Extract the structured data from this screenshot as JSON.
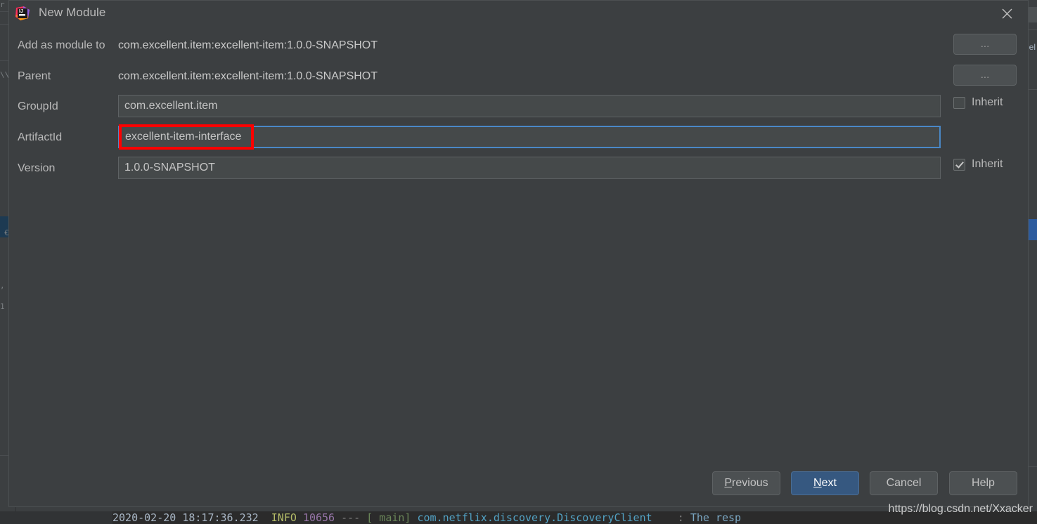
{
  "window": {
    "title": "New Module",
    "app_icon": "intellij-idea-icon",
    "close_icon": "close-icon"
  },
  "form": {
    "rows": [
      {
        "label": "Add as module to",
        "value": "com.excellent.item:excellent-item:1.0.0-SNAPSHOT",
        "type": "static",
        "browse_label": "..."
      },
      {
        "label": "Parent",
        "value": "com.excellent.item:excellent-item:1.0.0-SNAPSHOT",
        "type": "static",
        "browse_label": "..."
      },
      {
        "label": "GroupId",
        "value": "com.excellent.item",
        "type": "input",
        "inherit_label": "Inherit",
        "inherit_checked": false
      },
      {
        "label": "ArtifactId",
        "value": "excellent-item-interface",
        "type": "input",
        "focused": true
      },
      {
        "label": "Version",
        "value": "1.0.0-SNAPSHOT",
        "type": "input",
        "inherit_label": "Inherit",
        "inherit_checked": true
      }
    ]
  },
  "footer": {
    "previous": {
      "label": "Previous",
      "mnemonic": "P"
    },
    "next": {
      "label": "Next",
      "mnemonic": "N"
    },
    "cancel": {
      "label": "Cancel"
    },
    "help": {
      "label": "Help"
    }
  },
  "watermark": "https://blog.csdn.net/Xxacker",
  "console": {
    "timestamp": "2020-02-20 18:17:36.232",
    "level": "INFO",
    "pid": "10656",
    "separator": "---",
    "thread": "[  main]",
    "logger": "com.netflix.discovery.DiscoveryClient",
    "colon": ":",
    "message": "The resp"
  },
  "colors": {
    "dialog_bg": "#3c3f41",
    "input_bg": "#45494a",
    "accent_focus": "#4a88c7",
    "primary_button": "#365880",
    "annotation_red": "#fe0000",
    "text": "#b9b9b9"
  }
}
